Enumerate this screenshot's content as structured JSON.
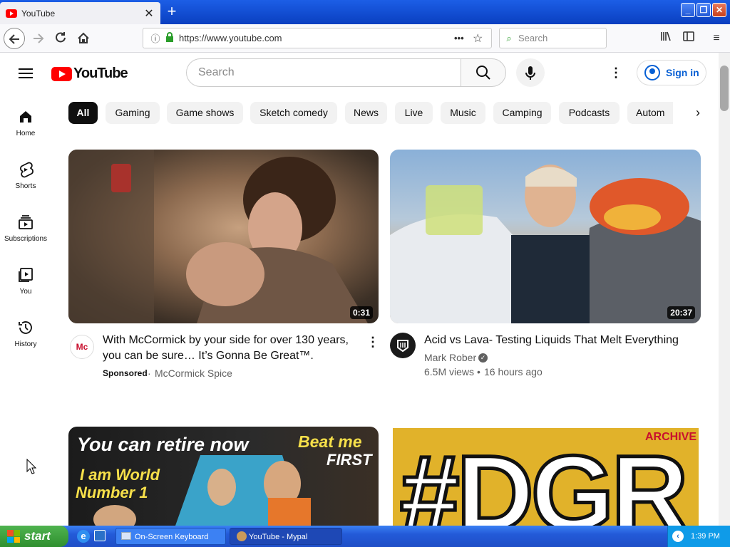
{
  "browser": {
    "tab_title": "YouTube",
    "tab_close": "✕",
    "new_tab": "+",
    "url": "https://www.youtube.com",
    "search_placeholder": "Search"
  },
  "youtube": {
    "logo_text": "YouTube",
    "search_placeholder": "Search",
    "signin_label": "Sign in",
    "guide": [
      {
        "label": "Home",
        "icon": "home-icon"
      },
      {
        "label": "Shorts",
        "icon": "shorts-icon"
      },
      {
        "label": "Subscriptions",
        "icon": "subscriptions-icon"
      },
      {
        "label": "You",
        "icon": "you-icon"
      },
      {
        "label": "History",
        "icon": "history-icon"
      }
    ],
    "chips": [
      "All",
      "Gaming",
      "Game shows",
      "Sketch comedy",
      "News",
      "Live",
      "Music",
      "Camping",
      "Podcasts",
      "Autom"
    ],
    "videos": [
      {
        "title_line1": "With McCormick by your side for over 130 years,",
        "title_line2": "you can be sure… It’s Gonna Be Great™.",
        "sponsored": "Sponsored",
        "channel": "McCormick Spice",
        "duration": "0:31",
        "avatar_text": "Mc"
      },
      {
        "title_line1": "Acid vs Lava- Testing Liquids That Melt Everything",
        "channel": "Mark Rober",
        "views": "6.5M views",
        "age": "16 hours ago",
        "duration": "20:37"
      },
      {
        "thumb_line1": "You can retire now",
        "thumb_line2": "I am World",
        "thumb_line3": "Number 1",
        "thumb_line4": "Beat me",
        "thumb_line5": "FIRST"
      },
      {
        "thumb_badge": "ARCHIVE",
        "thumb_text": "#DGR"
      }
    ]
  },
  "taskbar": {
    "start": "start",
    "tasks": [
      "On-Screen Keyboard",
      "YouTube - Mypal"
    ],
    "clock": "1:39 PM"
  },
  "colors": {
    "yt_red": "#ff0000",
    "link_blue": "#065fd4",
    "xp_blue": "#235ad8",
    "start_green": "#3a9a3a"
  }
}
